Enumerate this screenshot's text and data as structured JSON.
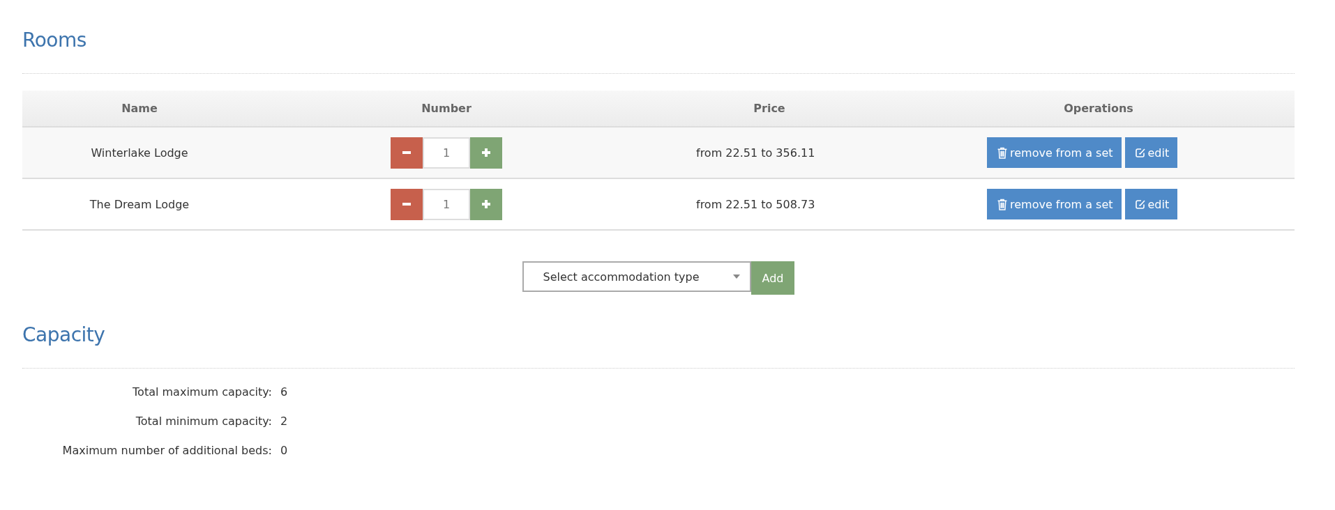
{
  "rooms_section": {
    "title": "Rooms"
  },
  "table": {
    "columns": [
      "Name",
      "Number",
      "Price",
      "Operations"
    ],
    "rows": [
      {
        "name": "Winterlake Lodge",
        "number": "1",
        "price": "from 22.51 to 356.11",
        "remove_label": "remove from a set",
        "edit_label": "edit"
      },
      {
        "name": "The Dream Lodge",
        "number": "1",
        "price": "from 22.51 to 508.73",
        "remove_label": "remove from a set",
        "edit_label": "edit"
      }
    ]
  },
  "add_form": {
    "select": "Select accommodation type",
    "button": "Add"
  },
  "capacity_section": {
    "title": "Capacity",
    "rows": [
      {
        "label": "Total maximum capacity:",
        "value": "6"
      },
      {
        "label": "Total minimum capacity:",
        "value": "2"
      },
      {
        "label": "Maximum number of additional beds:",
        "value": "0"
      }
    ]
  }
}
